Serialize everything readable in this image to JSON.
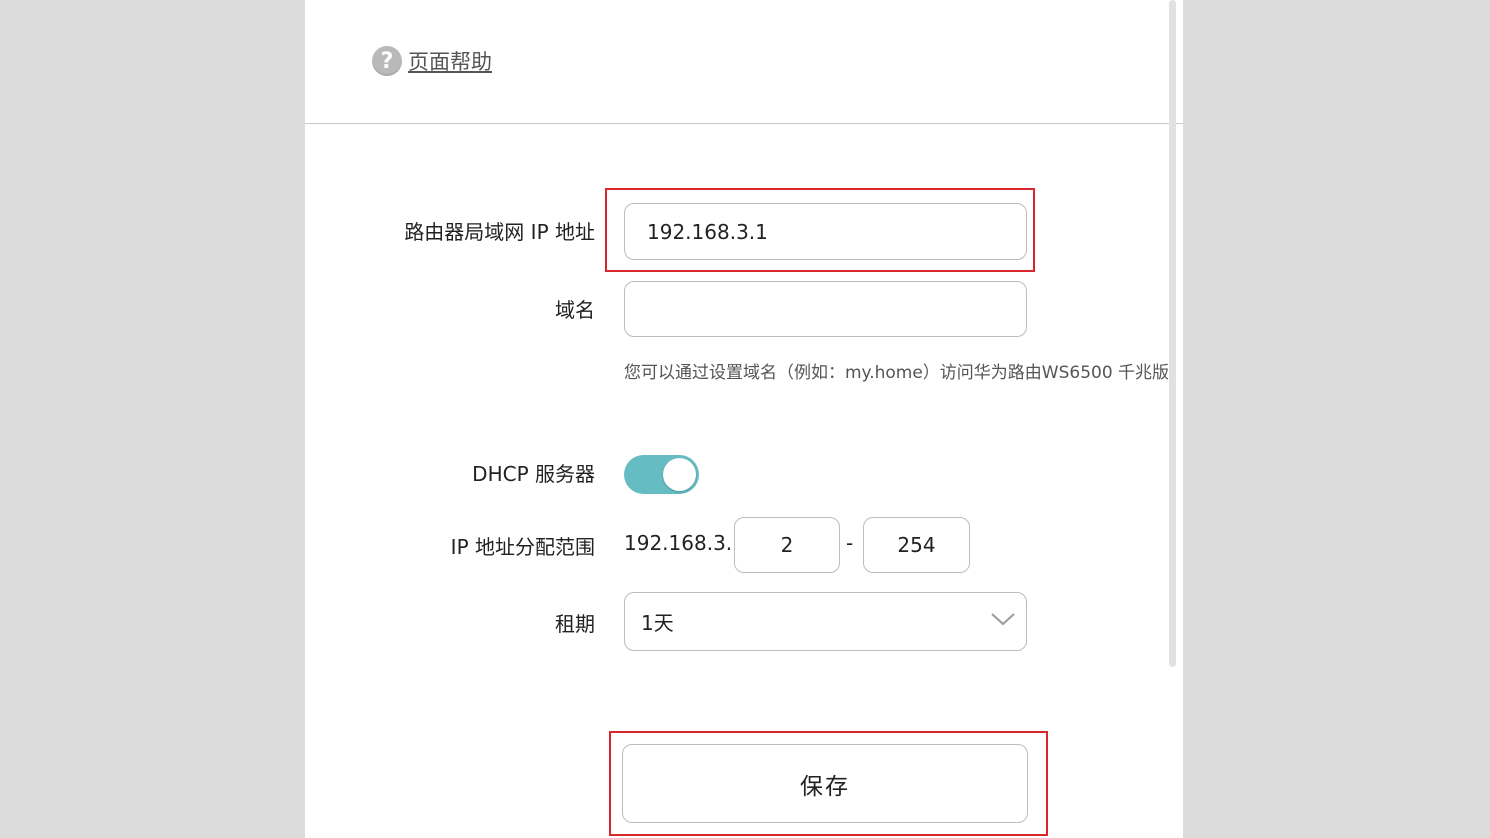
{
  "help": {
    "icon": "question-icon",
    "icon_glyph": "?",
    "link_label": "页面帮助"
  },
  "lan": {
    "ip_label": "路由器局域网 IP 地址",
    "ip_value": "192.168.3.1",
    "domain_label": "域名",
    "domain_value": "",
    "domain_hint": "您可以通过设置域名（例如：my.home）访问华为路由WS6500 千兆版"
  },
  "dhcp": {
    "server_label": "DHCP 服务器",
    "enabled": true,
    "toggle_color": "#65bcc2",
    "range_label": "IP 地址分配范围",
    "range_prefix": "192.168.3.",
    "range_start": "2",
    "range_separator": "-",
    "range_end": "254",
    "lease_label": "租期",
    "lease_value": "1天",
    "lease_icon": "chevron-down-icon"
  },
  "actions": {
    "save_label": "保存"
  },
  "highlight_color": "#d9262c"
}
